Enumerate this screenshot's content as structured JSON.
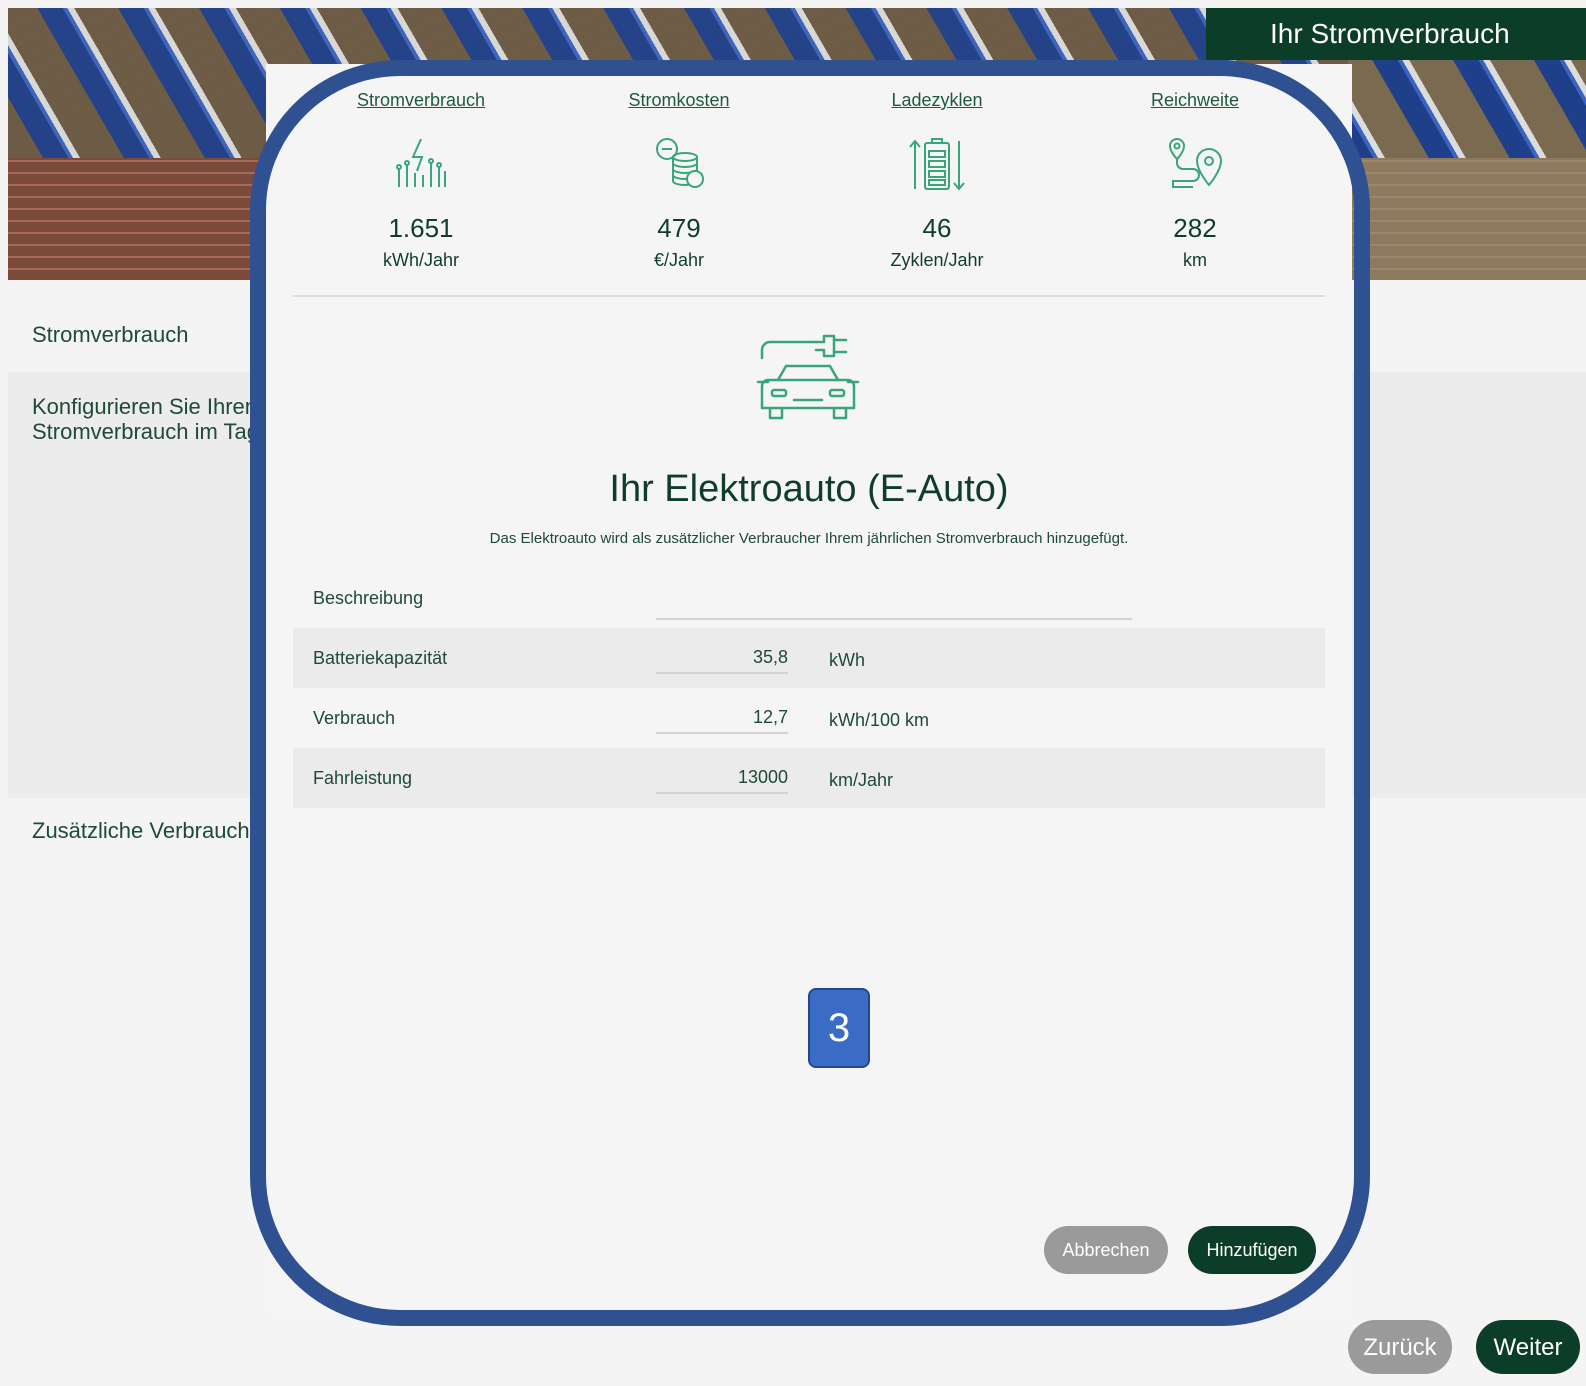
{
  "header": {
    "badge_title": "Ihr Stromverbrauch"
  },
  "background_page": {
    "section_consumption": "Stromverbrauch",
    "configure_text": "Konfigurieren Sie Ihren Stromverbrauch im Tag",
    "section_additional": "Zusätzliche Verbrauche",
    "back_button": "Zurück",
    "next_button": "Weiter"
  },
  "modal": {
    "stats": [
      {
        "label": "Stromverbrauch",
        "value": "1.651",
        "unit": "kWh/Jahr",
        "icon": "power-usage-icon"
      },
      {
        "label": "Stromkosten",
        "value": "479",
        "unit": "€/Jahr",
        "icon": "coins-cost-icon"
      },
      {
        "label": "Ladezyklen",
        "value": "46",
        "unit": "Zyklen/Jahr",
        "icon": "battery-cycle-icon"
      },
      {
        "label": "Reichweite",
        "value": "282",
        "unit": "km",
        "icon": "route-location-icon"
      }
    ],
    "title": "Ihr Elektroauto (E-Auto)",
    "subtitle": "Das Elektroauto wird als zusätzlicher Verbraucher Ihrem jährlichen Stromverbrauch hinzugefügt.",
    "fields": [
      {
        "label": "Beschreibung",
        "value": "",
        "unit": ""
      },
      {
        "label": "Batteriekapazität",
        "value": "35,8",
        "unit": "kWh"
      },
      {
        "label": "Verbrauch",
        "value": "12,7",
        "unit": "kWh/100 km"
      },
      {
        "label": "Fahrleistung",
        "value": "13000",
        "unit": "km/Jahr"
      }
    ],
    "cancel_button": "Abbrechen",
    "add_button": "Hinzufügen"
  },
  "annotation": {
    "step_number": "3"
  },
  "colors": {
    "brand_dark_green": "#0c3d28",
    "icon_green": "#3aa57a",
    "cancel_gray": "#9a9a9a",
    "frame_blue": "#2f5091",
    "badge_blue": "#3b6cc5"
  }
}
